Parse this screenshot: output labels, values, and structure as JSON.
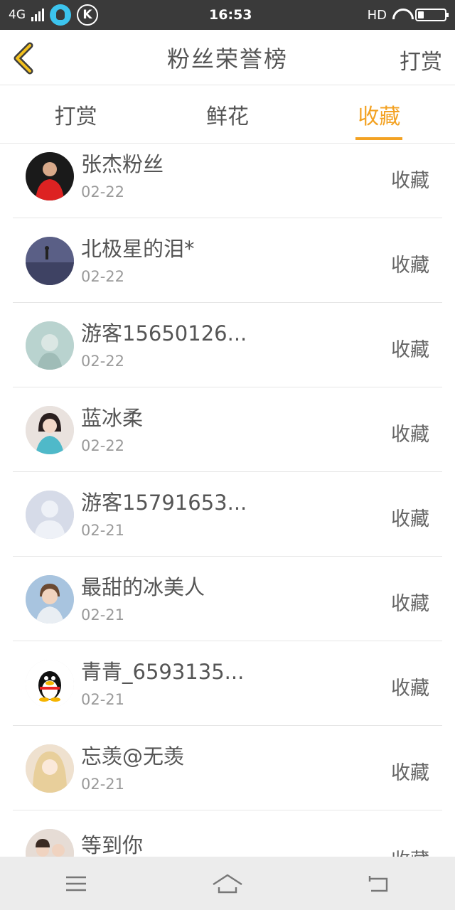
{
  "status_bar": {
    "network": "4G",
    "time": "16:53",
    "hd": "HD",
    "k_badge": "K"
  },
  "header": {
    "title": "粉丝荣誉榜",
    "right_action": "打赏"
  },
  "tabs": [
    {
      "label": "打赏",
      "active": false
    },
    {
      "label": "鲜花",
      "active": false
    },
    {
      "label": "收藏",
      "active": true
    }
  ],
  "accent_color": "#f3a223",
  "fans": [
    {
      "name": "张杰粉丝",
      "date": "02-22",
      "action": "收藏",
      "avatar": "person-red-jacket"
    },
    {
      "name": "北极星的泪*",
      "date": "02-22",
      "action": "收藏",
      "avatar": "night-sky"
    },
    {
      "name": "游客15650126...",
      "date": "02-22",
      "action": "收藏",
      "avatar": "pale-illustration"
    },
    {
      "name": "蓝冰柔",
      "date": "02-22",
      "action": "收藏",
      "avatar": "girl-portrait"
    },
    {
      "name": "游客15791653...",
      "date": "02-21",
      "action": "收藏",
      "avatar": "default-user"
    },
    {
      "name": "最甜的冰美人",
      "date": "02-21",
      "action": "收藏",
      "avatar": "boy-portrait"
    },
    {
      "name": "青青_6593135...",
      "date": "02-21",
      "action": "收藏",
      "avatar": "qq-penguin"
    },
    {
      "name": "忘羡@无羡",
      "date": "02-21",
      "action": "收藏",
      "avatar": "anime-girl"
    },
    {
      "name": "等到你",
      "date": "",
      "action": "收藏",
      "avatar": "couple-photo"
    }
  ],
  "nav_bar": {
    "items": [
      "menu-icon",
      "home-icon",
      "back-icon"
    ]
  }
}
